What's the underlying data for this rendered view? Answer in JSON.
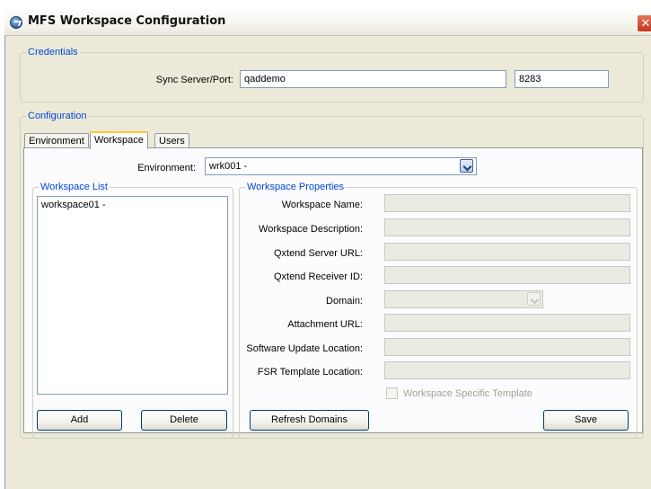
{
  "window": {
    "title": "MFS Workspace Configuration",
    "close_glyph": "✕"
  },
  "credentials": {
    "legend": "Credentials",
    "sync_label": "Sync Server/Port:",
    "server_value": "qaddemo",
    "port_value": "8283"
  },
  "configuration": {
    "legend": "Configuration",
    "tabs": [
      {
        "label": "Environment",
        "active": false
      },
      {
        "label": "Workspace",
        "active": true
      },
      {
        "label": "Users",
        "active": false
      }
    ]
  },
  "workspace_tab": {
    "environment_label": "Environment:",
    "environment_value": "wrk001 -",
    "list": {
      "legend": "Workspace List",
      "items": [
        "workspace01 -"
      ],
      "add_label": "Add",
      "delete_label": "Delete"
    },
    "properties": {
      "legend": "Workspace Properties",
      "fields": [
        {
          "label": "Workspace Name:",
          "value": ""
        },
        {
          "label": "Workspace Description:",
          "value": ""
        },
        {
          "label": "Qxtend Server URL:",
          "value": ""
        },
        {
          "label": "Qxtend Receiver ID:",
          "value": ""
        },
        {
          "label": "Domain:",
          "value": ""
        },
        {
          "label": "Attachment URL:",
          "value": ""
        },
        {
          "label": "Software Update Location:",
          "value": ""
        },
        {
          "label": "FSR Template Location:",
          "value": ""
        }
      ],
      "specific_template_label": "Workspace Specific Template",
      "specific_template_checked": false,
      "refresh_label": "Refresh Domains",
      "save_label": "Save"
    }
  },
  "icons": {
    "app": "mfs-app-icon",
    "close": "close-icon",
    "dropdown": "chevron-down-icon"
  }
}
